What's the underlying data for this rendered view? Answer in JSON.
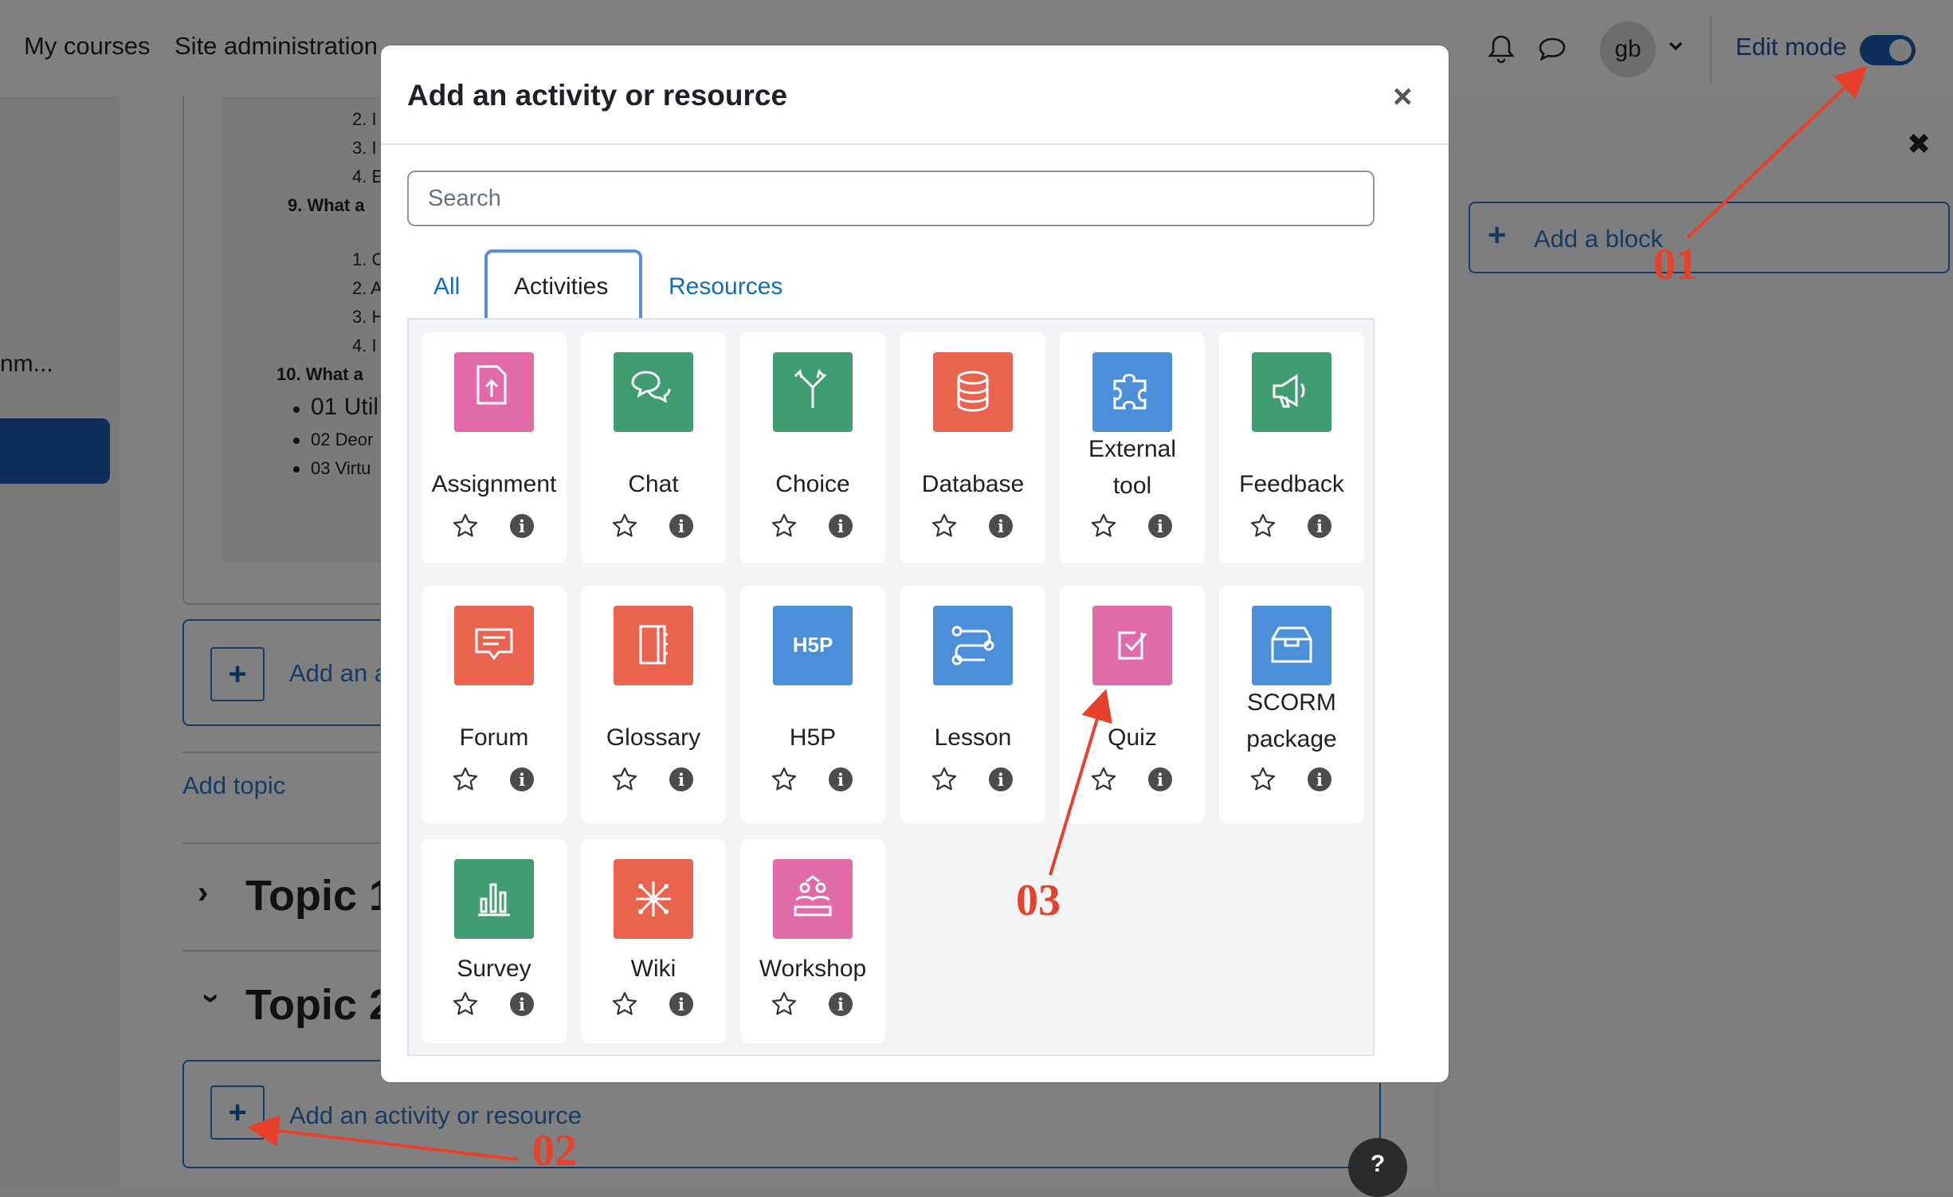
{
  "topbar": {
    "my_courses": "My courses",
    "site_admin": "Site administration",
    "avatar_initials": "gb",
    "edit_mode_label": "Edit mode",
    "edit_mode_on": true
  },
  "left_panel": {
    "truncated_text": "nm..."
  },
  "course": {
    "list": {
      "n2": "2. I",
      "n3": "3. I",
      "n4": "4. E",
      "q9": "9. What a",
      "m1": "1. C",
      "m2": "2. A",
      "m3": "3. H",
      "m4": "4. I",
      "q10": "10. What a",
      "b1": "01 Util",
      "b2": "02 Deor",
      "b3": "03 Virtu"
    },
    "add_activity_partial": "Add an a",
    "add_topic": "Add topic",
    "topic1": "Topic 1",
    "topic2": "Topic 2",
    "add_activity_full": "Add an activity or resource"
  },
  "block_panel": {
    "add_block": "Add a block"
  },
  "help": "?",
  "modal": {
    "title": "Add an activity or resource",
    "search_placeholder": "Search",
    "tabs": {
      "all": "All",
      "activities": "Activities",
      "resources": "Resources"
    },
    "active_tab": "Activities",
    "items": [
      {
        "name": "Assignment",
        "icon": "assignment-icon",
        "color": "#e06ba8"
      },
      {
        "name": "Chat",
        "icon": "chat-icon",
        "color": "#3f9d6f"
      },
      {
        "name": "Choice",
        "icon": "choice-icon",
        "color": "#3f9d6f"
      },
      {
        "name": "Database",
        "icon": "database-icon",
        "color": "#e9634f"
      },
      {
        "name": "External tool",
        "icon": "puzzle-icon",
        "color": "#4a8fd8"
      },
      {
        "name": "Feedback",
        "icon": "megaphone-icon",
        "color": "#3f9d6f"
      },
      {
        "name": "Forum",
        "icon": "forum-icon",
        "color": "#e9634f"
      },
      {
        "name": "Glossary",
        "icon": "glossary-icon",
        "color": "#e9634f"
      },
      {
        "name": "H5P",
        "icon": "h5p-icon",
        "color": "#4a8fd8"
      },
      {
        "name": "Lesson",
        "icon": "lesson-icon",
        "color": "#4a8fd8"
      },
      {
        "name": "Quiz",
        "icon": "quiz-icon",
        "color": "#e06ba8"
      },
      {
        "name": "SCORM package",
        "icon": "package-icon",
        "color": "#4a8fd8"
      },
      {
        "name": "Survey",
        "icon": "survey-icon",
        "color": "#3f9d6f"
      },
      {
        "name": "Wiki",
        "icon": "wiki-icon",
        "color": "#e9634f"
      },
      {
        "name": "Workshop",
        "icon": "workshop-icon",
        "color": "#e06ba8"
      }
    ],
    "h5p_glyph": "H5P"
  },
  "annotations": {
    "a01": "01",
    "a02": "02",
    "a03": "03",
    "color": "#e8402b"
  }
}
